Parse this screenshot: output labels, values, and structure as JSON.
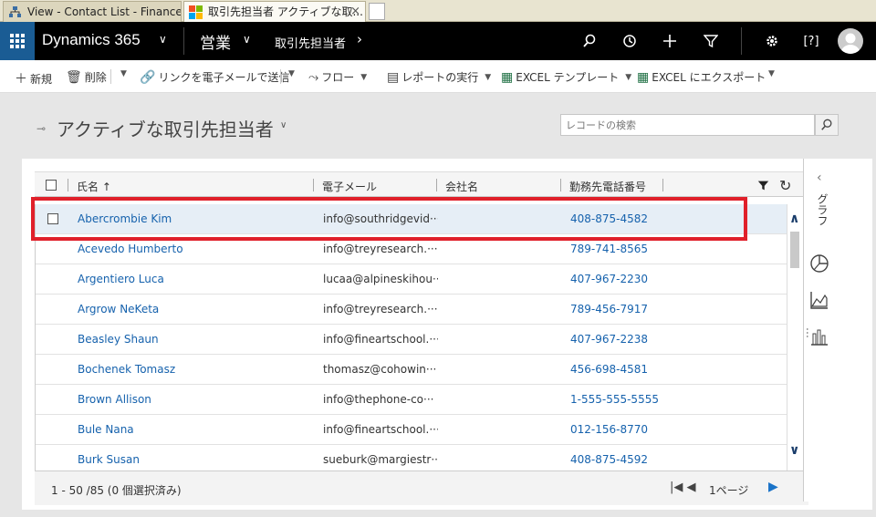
{
  "browser": {
    "tabs": [
      {
        "title": "View - Contact List - Finance a..."
      },
      {
        "title": "取引先担当者 アクティブな取...",
        "close": "×"
      }
    ]
  },
  "topnav": {
    "app_name": "Dynamics 365",
    "area": "営業",
    "entity": "取引先担当者"
  },
  "commands": {
    "new": "新規",
    "delete": "削除",
    "email_link": "リンクを電子メールで送信",
    "flow": "フロー",
    "run_report": "レポートの実行",
    "excel_template": "EXCEL テンプレート",
    "export_excel": "EXCEL にエクスポート"
  },
  "view": {
    "title": "アクティブな取引先担当者",
    "search_placeholder": "レコードの検索"
  },
  "grid": {
    "columns": {
      "name": "氏名 ↑",
      "email": "電子メール",
      "company": "会社名",
      "phone": "勤務先電話番号"
    },
    "rows": [
      {
        "name": "Abercrombie Kim",
        "email": "info@southridgevid···",
        "company": "",
        "phone": "408-875-4582",
        "selected": true
      },
      {
        "name": "Acevedo Humberto",
        "email": "info@treyresearch.···",
        "company": "",
        "phone": "789-741-8565"
      },
      {
        "name": "Argentiero Luca",
        "email": "lucaa@alpineskihou···",
        "company": "",
        "phone": "407-967-2230"
      },
      {
        "name": "Argrow NeKeta",
        "email": "info@treyresearch.···",
        "company": "",
        "phone": "789-456-7917"
      },
      {
        "name": "Beasley Shaun",
        "email": "info@fineartschool.···",
        "company": "",
        "phone": "407-967-2238"
      },
      {
        "name": "Bochenek Tomasz",
        "email": "thomasz@cohowin···",
        "company": "",
        "phone": "456-698-4581"
      },
      {
        "name": "Brown Allison",
        "email": "info@thephone-co···",
        "company": "",
        "phone": "1-555-555-5555"
      },
      {
        "name": "Bule Nana",
        "email": "info@fineartschool.···",
        "company": "",
        "phone": "012-156-8770"
      },
      {
        "name": "Burk Susan",
        "email": "sueburk@margiestr···",
        "company": "",
        "phone": "408-875-4592"
      }
    ]
  },
  "footer": {
    "record_count": "1 - 50 /85 (0 個選択済み)",
    "page": "1ページ"
  },
  "sidepane": {
    "label": "グラフ"
  }
}
